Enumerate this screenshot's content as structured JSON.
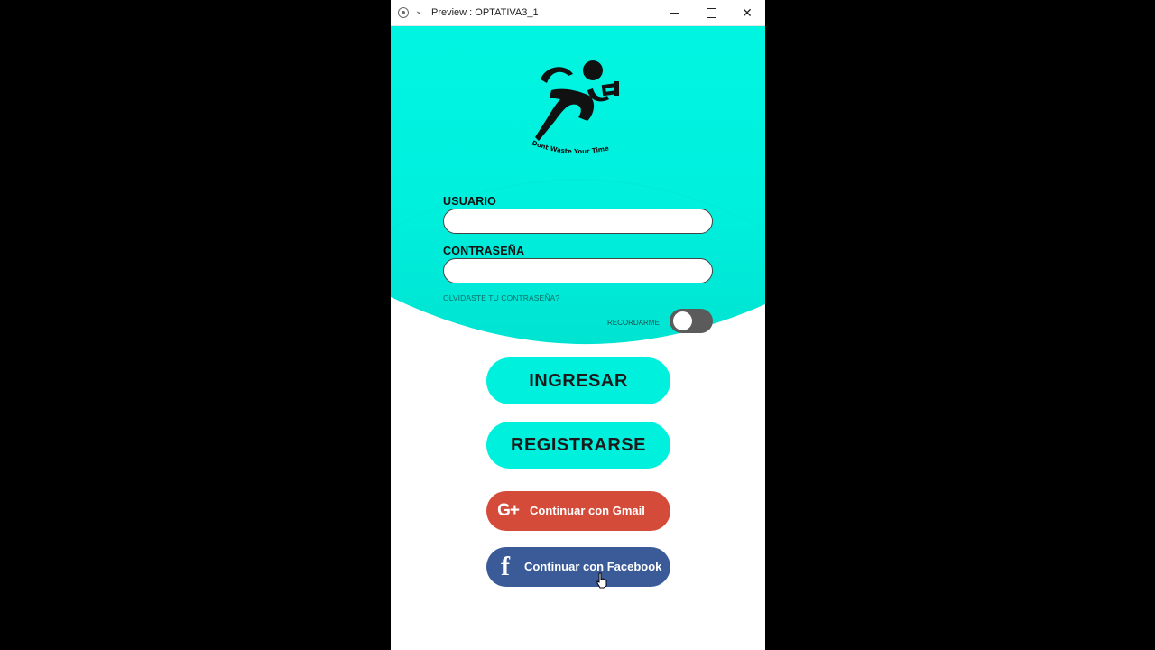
{
  "window": {
    "title": "Preview : OPTATIVA3_1"
  },
  "logo": {
    "tagline": "Dont Waste Your Time"
  },
  "form": {
    "username_label": "USUARIO",
    "username_value": "",
    "password_label": "CONTRASEÑA",
    "password_value": "",
    "forgot_password": "OLVIDASTE TU CONTRASEÑA?",
    "remember_label": "RECORDARME",
    "remember_on": false
  },
  "actions": {
    "login": "INGRESAR",
    "register": "REGISTRARSE",
    "gmail": "Continuar con Gmail",
    "facebook": "Continuar con Facebook"
  },
  "icons": {
    "gmail": "G+",
    "facebook": "f"
  },
  "colors": {
    "accent": "#00f0de",
    "gmail": "#d44b3a",
    "facebook": "#3a5a98",
    "toggle_off": "#5b5b5b"
  }
}
